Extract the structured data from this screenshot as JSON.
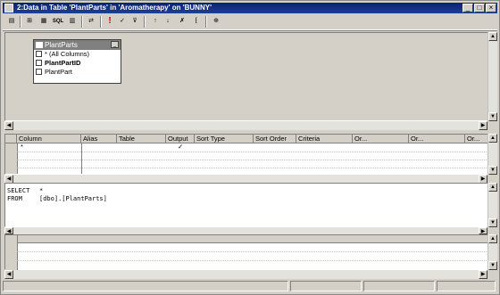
{
  "window": {
    "title": "2:Data in Table 'PlantParts' in 'Aromatherapy' on 'BUNNY'",
    "minimize": "_",
    "maximize": "□",
    "close": "×"
  },
  "toolbar": {
    "items": [
      {
        "name": "properties-icon",
        "glyph": "▤"
      },
      {
        "name": "diagram-pane-icon",
        "glyph": "⊞"
      },
      {
        "name": "grid-pane-icon",
        "glyph": "▦"
      },
      {
        "name": "sql-pane-label",
        "glyph": "SQL"
      },
      {
        "name": "results-pane-icon",
        "glyph": "▥"
      },
      {
        "name": "change-type-icon",
        "glyph": "⇄"
      },
      {
        "name": "run-icon",
        "glyph": "!"
      },
      {
        "name": "verify-sql-icon",
        "glyph": "✓"
      },
      {
        "name": "remove-filter-icon",
        "glyph": "⊽"
      },
      {
        "name": "sort-ascending-icon",
        "glyph": "↑"
      },
      {
        "name": "sort-descending-icon",
        "glyph": "↓"
      },
      {
        "name": "remove-filter2-icon",
        "glyph": "✗"
      },
      {
        "name": "use-group-by-icon",
        "glyph": "⁅"
      },
      {
        "name": "add-table-icon",
        "glyph": "⊕"
      }
    ]
  },
  "diagram": {
    "table": {
      "title": "PlantParts",
      "columns": [
        {
          "label": "* (All Columns)",
          "bold": false
        },
        {
          "label": "PlantPartID",
          "bold": true
        },
        {
          "label": "PlantPart",
          "bold": false
        }
      ]
    }
  },
  "grid": {
    "headers": [
      "Column",
      "Alias",
      "Table",
      "Output",
      "Sort Type",
      "Sort Order",
      "Criteria",
      "Or...",
      "Or...",
      "Or..."
    ],
    "row1": {
      "column": "*",
      "output": "✓"
    }
  },
  "sql": {
    "line1_keyword": "SELECT",
    "line1_value": "*",
    "line2_keyword": "FROM",
    "line2_value": "[dbo].[PlantParts]"
  },
  "status": {
    "cells": [
      "",
      "",
      "",
      ""
    ]
  }
}
